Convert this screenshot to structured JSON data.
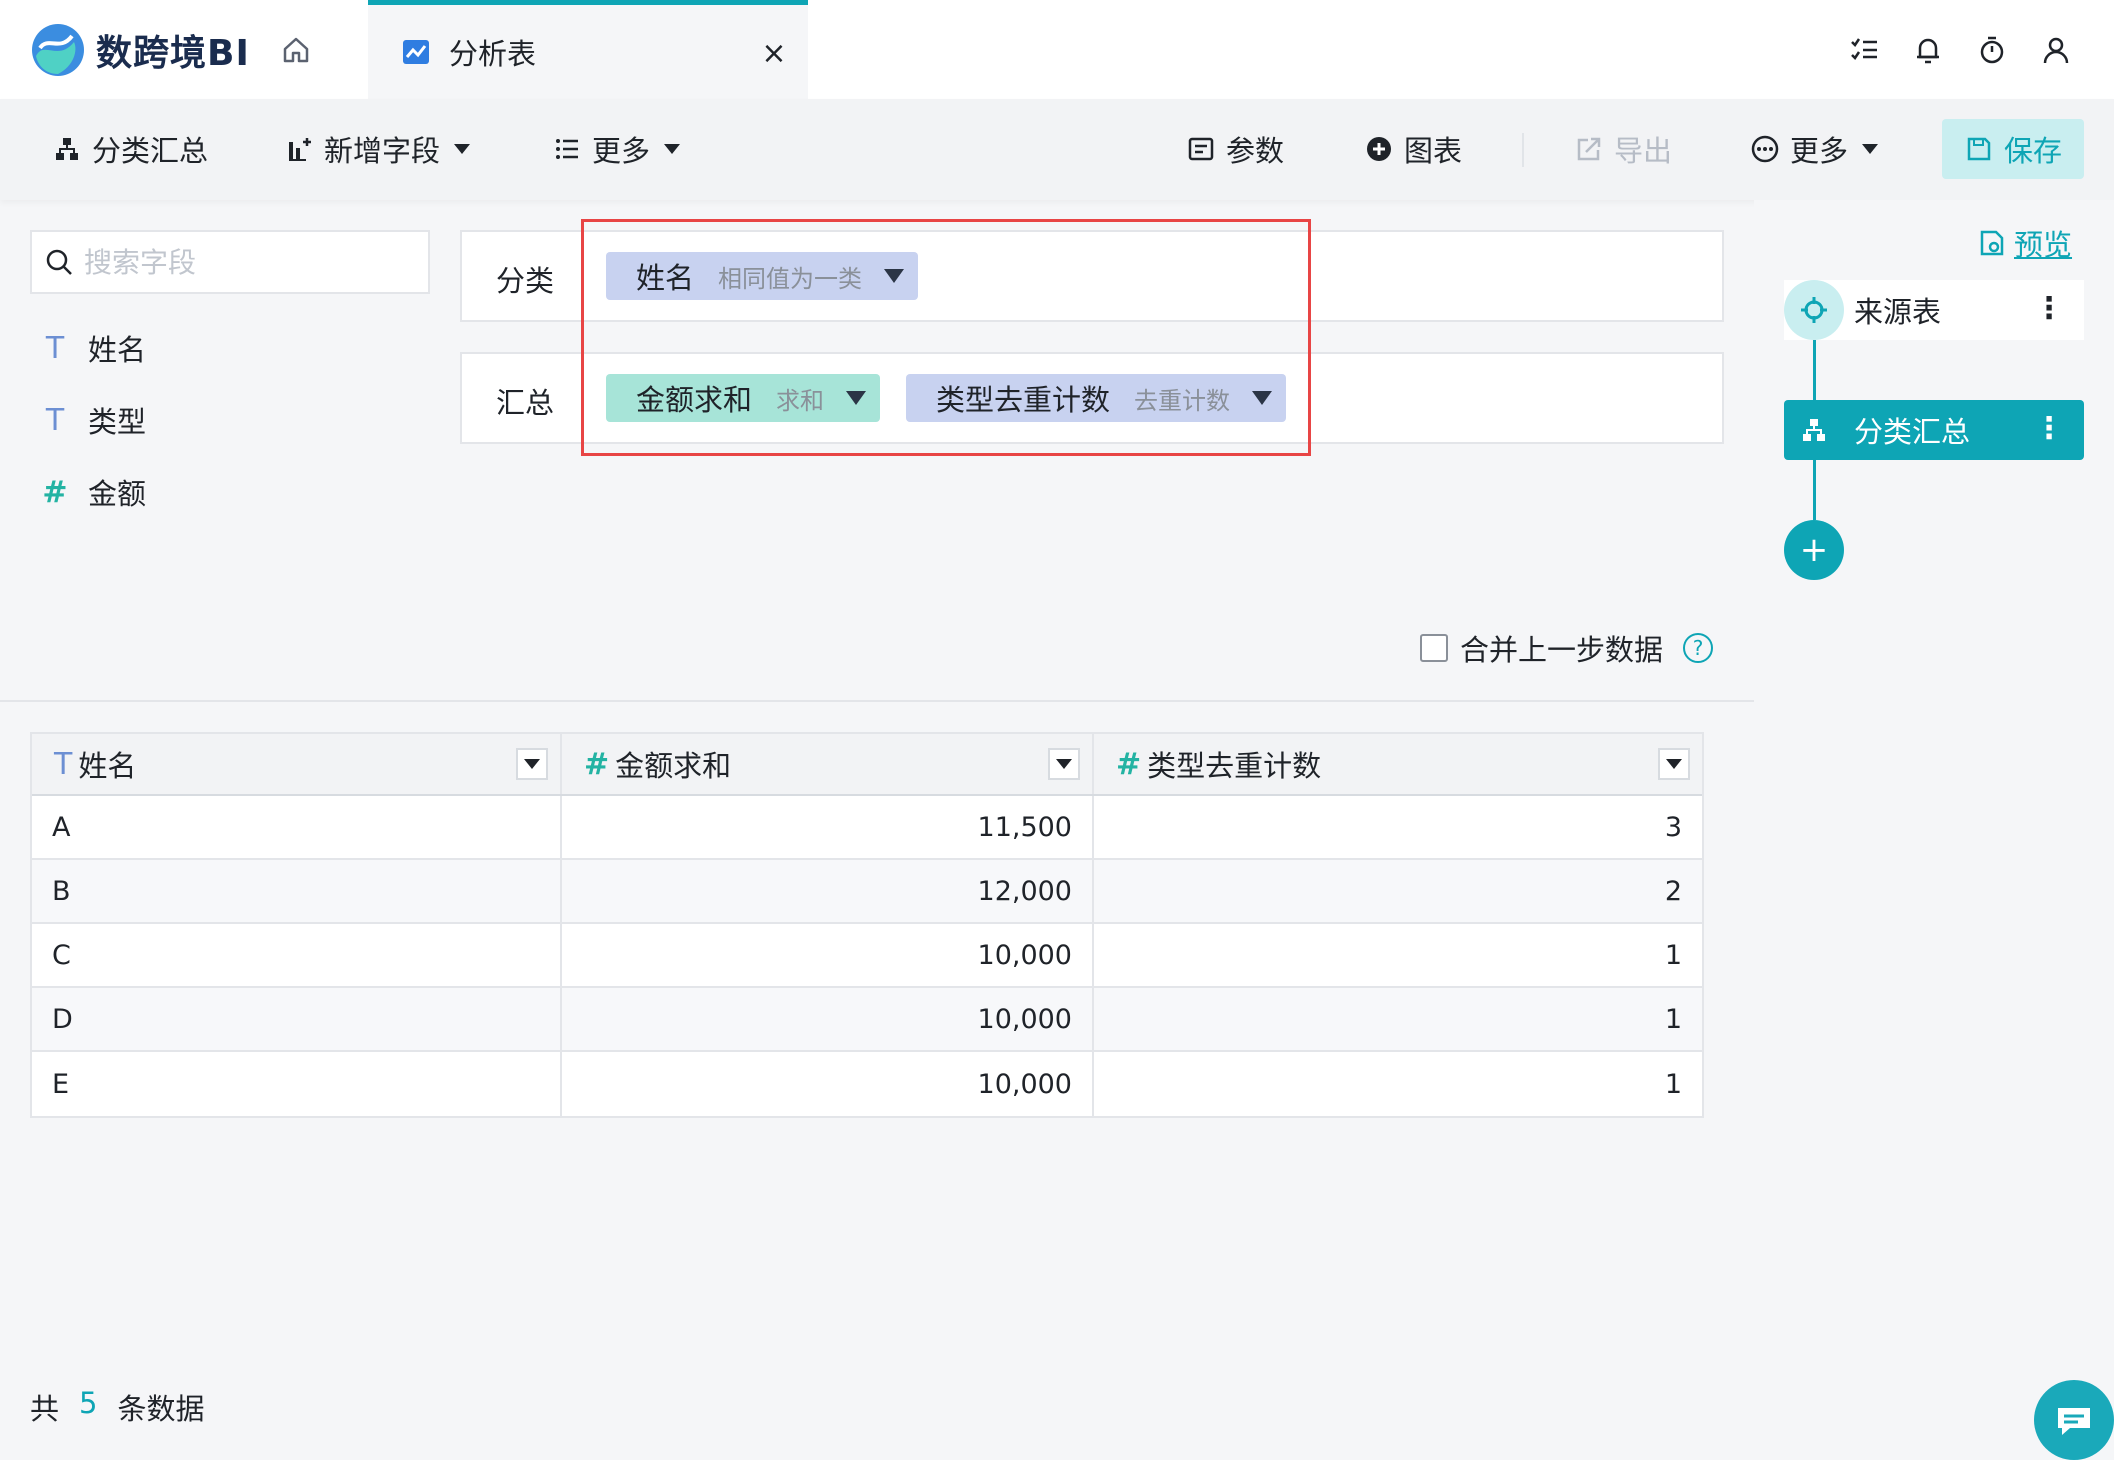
{
  "app": {
    "logo_text": "数跨境BI",
    "tab_label": "分析表",
    "tab_close": "×"
  },
  "toolbar": {
    "group_summary": "分类汇总",
    "add_field": "新增字段",
    "more_left": "更多",
    "params": "参数",
    "chart": "图表",
    "export": "导出",
    "more_right": "更多",
    "save": "保存"
  },
  "fields": {
    "search_placeholder": "搜索字段",
    "items": [
      {
        "type": "T",
        "name": "姓名"
      },
      {
        "type": "T",
        "name": "类型"
      },
      {
        "type": "#",
        "name": "金额"
      }
    ]
  },
  "config": {
    "group_label": "分类",
    "group_chip": {
      "name": "姓名",
      "mode": "相同值为一类"
    },
    "summary_label": "汇总",
    "summary_chips": [
      {
        "name": "金额求和",
        "mode": "求和"
      },
      {
        "name": "类型去重计数",
        "mode": "去重计数"
      }
    ],
    "merge_label": "合并上一步数据",
    "help": "?"
  },
  "table": {
    "headers": [
      {
        "type": "T",
        "label": "姓名"
      },
      {
        "type": "#",
        "label": "金额求和"
      },
      {
        "type": "#",
        "label": "类型去重计数"
      }
    ],
    "rows": [
      [
        "A",
        "11,500",
        "3"
      ],
      [
        "B",
        "12,000",
        "2"
      ],
      [
        "C",
        "10,000",
        "1"
      ],
      [
        "D",
        "10,000",
        "1"
      ],
      [
        "E",
        "10,000",
        "1"
      ]
    ]
  },
  "footer": {
    "prefix": "共",
    "count": "5",
    "suffix": "条数据"
  },
  "pipeline": {
    "preview": "预览",
    "source_node": "来源表",
    "group_node": "分类汇总",
    "add": "+"
  },
  "colors": {
    "accent": "#0ea5b5",
    "highlight": "#e84545",
    "chip_blue": "#c8d2f0",
    "chip_green": "#a7e4d8"
  }
}
